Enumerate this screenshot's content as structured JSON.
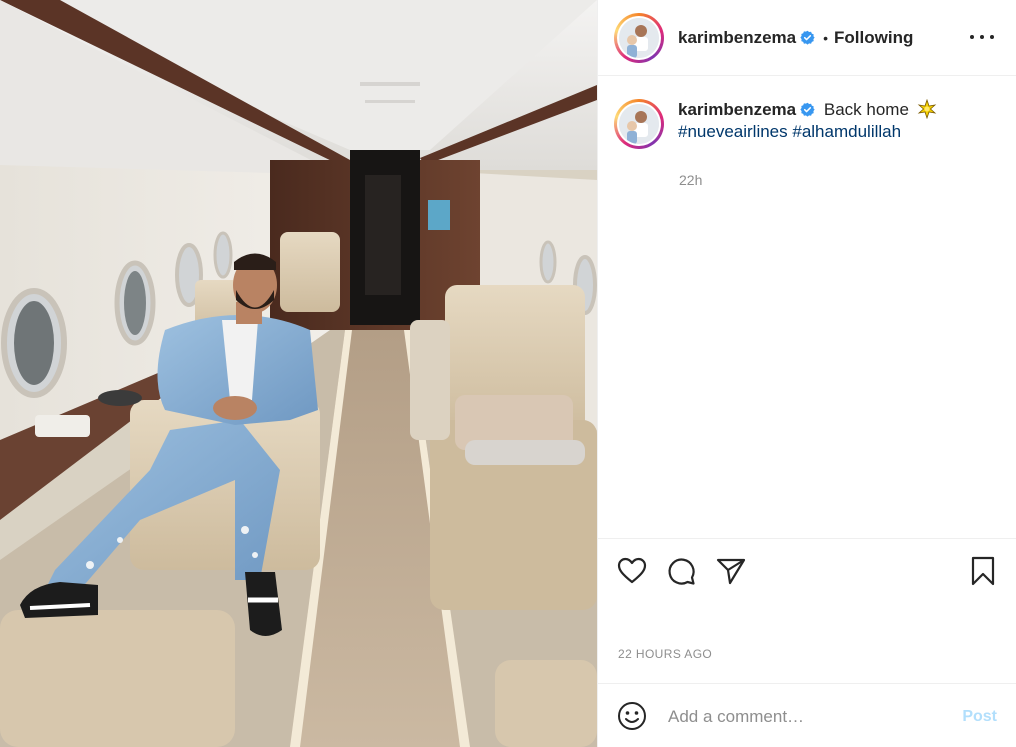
{
  "post": {
    "author": "karimbenzema",
    "verified": true,
    "separator": "•",
    "follow_state": "Following",
    "caption": {
      "text": "Back home",
      "emoji": "sparkle-star",
      "hashtags": [
        "#nueveairlines",
        "#alhamdulillah"
      ],
      "relative_time": "22h"
    },
    "timestamp_label": "22 HOURS AGO"
  },
  "comment": {
    "placeholder": "Add a comment…",
    "post_label": "Post"
  },
  "icons": {
    "like": "heart-icon",
    "comment": "comment-bubble-icon",
    "share": "paper-plane-icon",
    "save": "bookmark-icon",
    "more": "more-options-icon",
    "emoji": "emoji-smiley-icon",
    "verified": "verified-badge-icon"
  },
  "colors": {
    "verified_blue": "#3897f0",
    "hashtag": "#00376b",
    "muted": "#8e8e8e",
    "post_disabled": "#b2dffc"
  }
}
